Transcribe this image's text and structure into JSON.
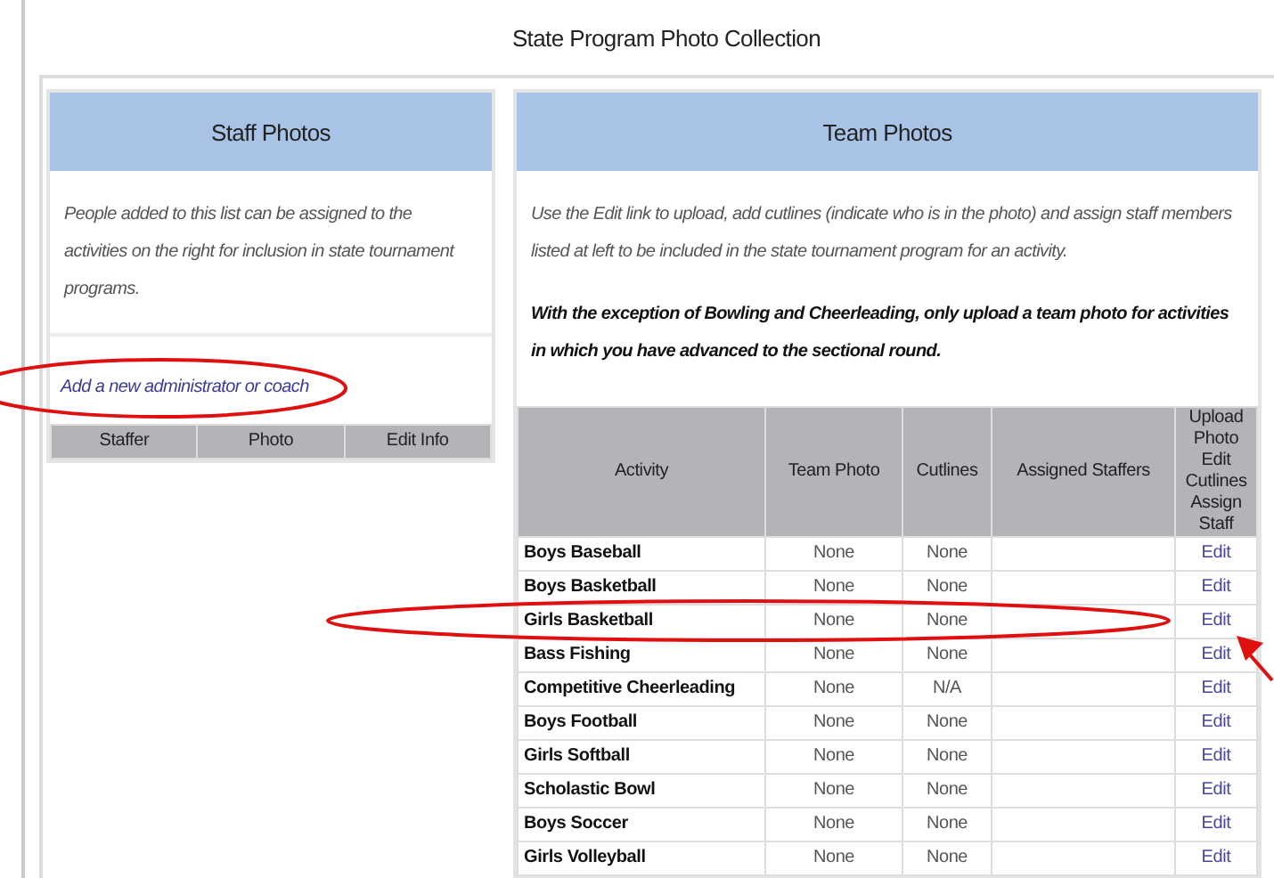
{
  "title": "State Program Photo Collection",
  "staff": {
    "heading": "Staff Photos",
    "intro": "People added to this list can be assigned to the activities on the right for inclusion in state tournament programs.",
    "add_link": "Add a new administrator or coach",
    "columns": [
      "Staffer",
      "Photo",
      "Edit Info"
    ]
  },
  "team": {
    "heading": "Team Photos",
    "intro": "Use the Edit link to upload, add cutlines (indicate who is in the photo) and assign staff members listed at left to be included in the state tournament program for an activity.",
    "notice": "With the exception of Bowling and Cheerleading, only upload a team photo for activities in which you have advanced to the sectional round.",
    "columns": [
      "Activity",
      "Team Photo",
      "Cutlines",
      "Assigned Staffers",
      "Upload Photo Edit Cutlines Assign Staff"
    ],
    "rows": [
      {
        "activity": "Boys Baseball",
        "team_photo": "None",
        "cutlines": "None",
        "action": "Edit"
      },
      {
        "activity": "Boys Basketball",
        "team_photo": "None",
        "cutlines": "None",
        "action": "Edit"
      },
      {
        "activity": "Girls Basketball",
        "team_photo": "None",
        "cutlines": "None",
        "action": "Edit"
      },
      {
        "activity": "Bass Fishing",
        "team_photo": "None",
        "cutlines": "None",
        "action": "Edit"
      },
      {
        "activity": "Competitive Cheerleading",
        "team_photo": "None",
        "cutlines": "N/A",
        "action": "Edit"
      },
      {
        "activity": "Boys Football",
        "team_photo": "None",
        "cutlines": "None",
        "action": "Edit"
      },
      {
        "activity": "Girls Softball",
        "team_photo": "None",
        "cutlines": "None",
        "action": "Edit"
      },
      {
        "activity": "Scholastic Bowl",
        "team_photo": "None",
        "cutlines": "None",
        "action": "Edit"
      },
      {
        "activity": "Boys Soccer",
        "team_photo": "None",
        "cutlines": "None",
        "action": "Edit"
      },
      {
        "activity": "Girls Volleyball",
        "team_photo": "None",
        "cutlines": "None",
        "action": "Edit"
      }
    ]
  }
}
